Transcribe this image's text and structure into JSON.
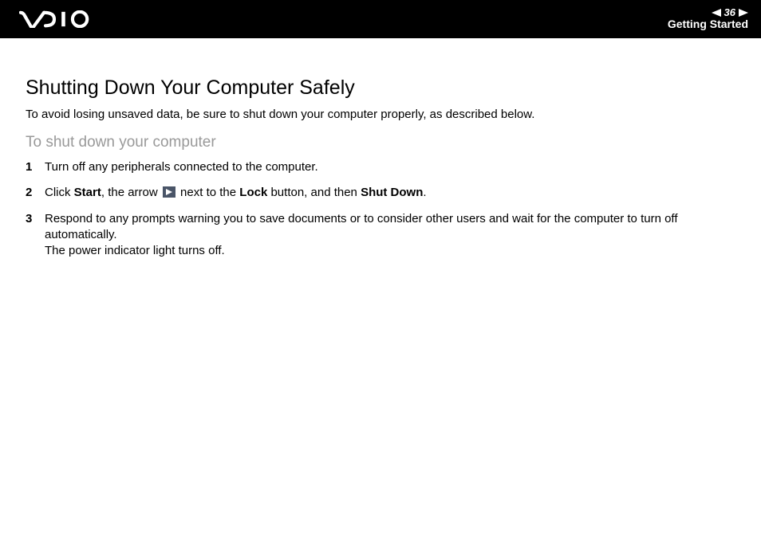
{
  "header": {
    "page_number": "36",
    "section": "Getting Started"
  },
  "content": {
    "title": "Shutting Down Your Computer Safely",
    "intro": "To avoid losing unsaved data, be sure to shut down your computer properly, as described below.",
    "subheading": "To shut down your computer",
    "steps": [
      {
        "num": "1",
        "text": "Turn off any peripherals connected to the computer."
      },
      {
        "num": "2",
        "prefix": "Click ",
        "b1": "Start",
        "mid1": ", the arrow ",
        "mid2": " next to the ",
        "b2": "Lock",
        "mid3": " button, and then ",
        "b3": "Shut Down",
        "suffix": "."
      },
      {
        "num": "3",
        "line1": "Respond to any prompts warning you to save documents or to consider other users and wait for the computer to turn off automatically.",
        "line2": "The power indicator light turns off."
      }
    ]
  }
}
